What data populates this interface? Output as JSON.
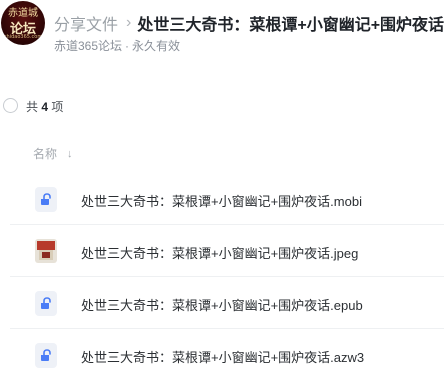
{
  "header": {
    "avatar_text_top": "赤道城",
    "avatar_text_mid": "论坛",
    "avatar_text_bot": "chidao365.com",
    "breadcrumb_parent": "分享文件",
    "breadcrumb_sep": "›",
    "title": "处世三大奇书：菜根谭+小窗幽记+围炉夜话",
    "owner": "赤道365论坛",
    "dot": "·",
    "validity": "永久有效"
  },
  "list": {
    "count_prefix": "共",
    "count_value": "4",
    "count_suffix": "项",
    "column_name": "名称",
    "sort_arrow": "↓",
    "files": [
      {
        "name": "处世三大奇书：菜根谭+小窗幽记+围炉夜话.mobi",
        "icon": "document-file-icon"
      },
      {
        "name": "处世三大奇书：菜根谭+小窗幽记+围炉夜话.jpeg",
        "icon": "image-thumbnail-icon"
      },
      {
        "name": "处世三大奇书：菜根谭+小窗幽记+围炉夜话.epub",
        "icon": "document-file-icon"
      },
      {
        "name": "处世三大奇书：菜根谭+小窗幽记+围炉夜话.azw3",
        "icon": "document-file-icon"
      }
    ]
  },
  "colors": {
    "text_primary": "#1f2329",
    "text_muted": "#9aa0a6",
    "file_icon_accent": "#4a7cf6"
  }
}
